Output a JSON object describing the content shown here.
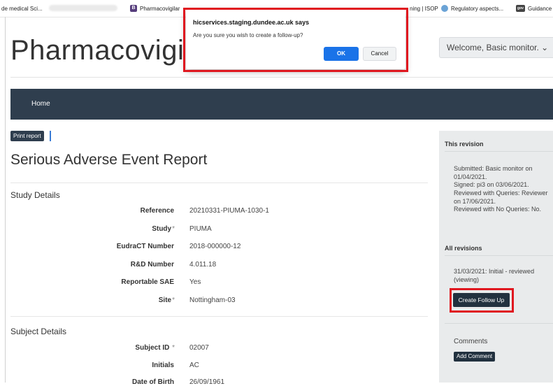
{
  "bookmarks": [
    {
      "label": "de medical Sci...",
      "icon": "medical-sci-icon"
    },
    {
      "label": "Pharmacovigilar",
      "icon": "B",
      "color": "#563d7c"
    },
    {
      "label": "ning | ISOP",
      "icon": "isop-icon"
    },
    {
      "label": "Regulatory aspects...",
      "icon": "leaf-icon",
      "color": "#6ba3d6"
    },
    {
      "label": "Guidance",
      "icon": "gov",
      "color": "#444444"
    }
  ],
  "header": {
    "brand": "Pharmacovigi",
    "welcome": "Welcome, Basic monitor. ⌄"
  },
  "nav": {
    "home": "Home"
  },
  "main": {
    "print_report": "Print report",
    "title": "Serious Adverse Event Report",
    "study_details": {
      "heading": "Study Details",
      "fields": [
        {
          "label": "Reference",
          "value": "20210331-PIUMA-1030-1",
          "required": ""
        },
        {
          "label": "Study",
          "value": "PIUMA",
          "required": "*"
        },
        {
          "label": "EudraCT Number",
          "value": "2018-000000-12",
          "required": ""
        },
        {
          "label": "R&D Number",
          "value": "4.011.18",
          "required": ""
        },
        {
          "label": "Reportable SAE",
          "value": "Yes",
          "required": ""
        },
        {
          "label": "Site",
          "value": "Nottingham-03",
          "required": "*"
        }
      ]
    },
    "subject_details": {
      "heading": "Subject Details",
      "fields": [
        {
          "label": "Subject ID",
          "value": "02007",
          "required": " *"
        },
        {
          "label": "Initials",
          "value": "AC",
          "required": ""
        },
        {
          "label": "Date of Birth",
          "value": "26/09/1961",
          "required": ""
        }
      ]
    }
  },
  "sidebar": {
    "this_revision": "This revision",
    "revision_lines": [
      "Submitted: Basic monitor on 01/04/2021.",
      "Signed: pi3 on 03/06/2021.",
      "Reviewed with Queries: Reviewer on 17/06/2021.",
      "Reviewed with No Queries: No."
    ],
    "all_revisions": "All revisions",
    "revision_entry": "31/03/2021: Initial - reviewed (viewing)",
    "create_follow_up": "Create Follow Up",
    "comments": "Comments",
    "add_comment": "Add Comment"
  },
  "dialog": {
    "title": "hicservices.staging.dundee.ac.uk says",
    "message": "Are you sure you wish to create a follow-up?",
    "ok": "OK",
    "cancel": "Cancel"
  },
  "colors": {
    "navbar": "#2f3e4e",
    "button_dark": "#22313f",
    "highlight": "#e0171f",
    "ok_button": "#1a73e8"
  }
}
